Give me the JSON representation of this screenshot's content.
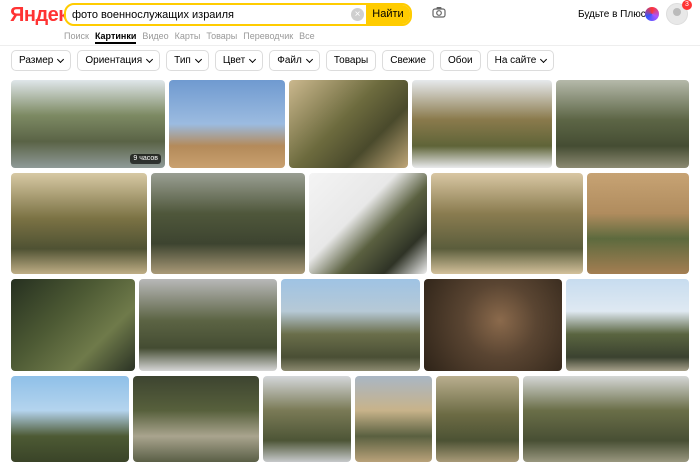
{
  "header": {
    "logo_text": "Яндекс",
    "search_value": "фото военнослужащих израиля",
    "find_label": "Найти",
    "plus_label": "Будьте в Плюсе",
    "notif_count": "3"
  },
  "tabs": [
    {
      "label": "Поиск",
      "active": false
    },
    {
      "label": "Картинки",
      "active": true
    },
    {
      "label": "Видео",
      "active": false
    },
    {
      "label": "Карты",
      "active": false
    },
    {
      "label": "Товары",
      "active": false
    },
    {
      "label": "Переводчик",
      "active": false
    },
    {
      "label": "Все",
      "active": false
    }
  ],
  "filters": [
    {
      "label": "Размер",
      "dropdown": true
    },
    {
      "label": "Ориентация",
      "dropdown": true
    },
    {
      "label": "Тип",
      "dropdown": true
    },
    {
      "label": "Цвет",
      "dropdown": true
    },
    {
      "label": "Файл",
      "dropdown": true
    },
    {
      "label": "Товары",
      "dropdown": false
    },
    {
      "label": "Свежие",
      "dropdown": false
    },
    {
      "label": "Обои",
      "dropdown": false
    },
    {
      "label": "На сайте",
      "dropdown": true
    }
  ],
  "colors": {
    "accent": "#ffcc00",
    "logo_red": "#ff3333"
  },
  "first_image_badge": "9 часов"
}
